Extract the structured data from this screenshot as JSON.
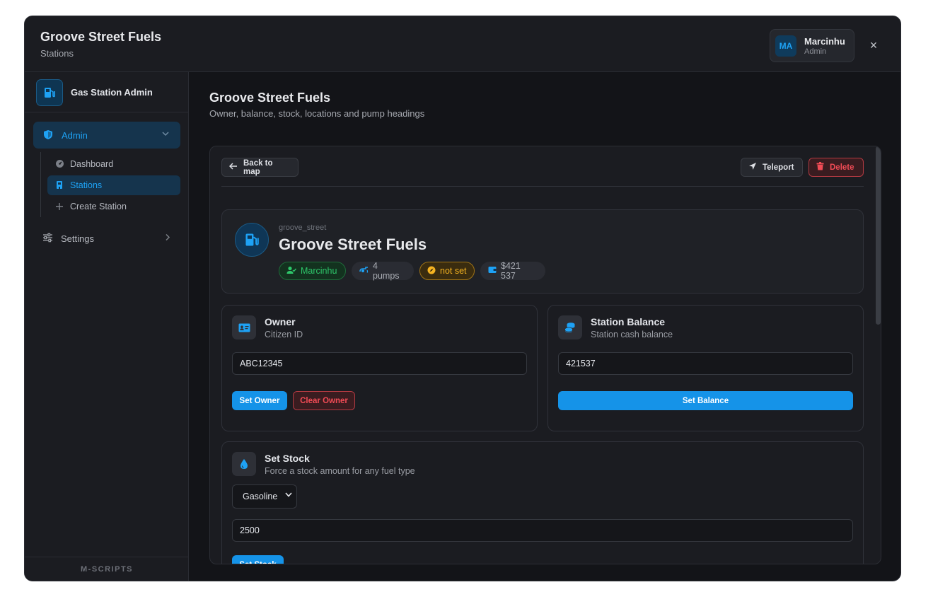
{
  "header": {
    "title": "Groove Street Fuels",
    "subtitle": "Stations",
    "user": {
      "initials": "MA",
      "name": "Marcinhu",
      "role": "Admin"
    },
    "close_label": "×"
  },
  "sidebar": {
    "brand": "Gas Station Admin",
    "admin_label": "Admin",
    "items": [
      {
        "label": "Dashboard",
        "icon": "gauge-icon"
      },
      {
        "label": "Stations",
        "icon": "building-icon",
        "active": true
      },
      {
        "label": "Create Station",
        "icon": "plus-icon"
      }
    ],
    "settings_label": "Settings",
    "footer": "M-SCRIPTS"
  },
  "main": {
    "title": "Groove Street Fuels",
    "subtitle": "Owner, balance, stock, locations and pump headings"
  },
  "toolbar": {
    "back_label": "Back to map",
    "teleport_label": "Teleport",
    "delete_label": "Delete"
  },
  "station": {
    "slug": "groove_street",
    "name": "Groove Street Fuels",
    "owner_pill": "Marcinhu",
    "pumps_pill": "4 pumps",
    "heading_pill": "not set",
    "balance_pill": "$421 537"
  },
  "owner_card": {
    "title": "Owner",
    "subtitle": "Citizen ID",
    "value": "ABC12345",
    "set_label": "Set Owner",
    "clear_label": "Clear Owner"
  },
  "balance_card": {
    "title": "Station Balance",
    "subtitle": "Station cash balance",
    "value": "421537",
    "set_label": "Set Balance"
  },
  "stock_card": {
    "title": "Set Stock",
    "subtitle": "Force a stock amount for any fuel type",
    "fuel_selected": "Gasoline",
    "value": "2500",
    "set_label": "Set Stock"
  },
  "colors": {
    "accent": "#1593e8",
    "danger": "#f04b55",
    "success": "#2ec66a",
    "warning": "#f5b321"
  }
}
